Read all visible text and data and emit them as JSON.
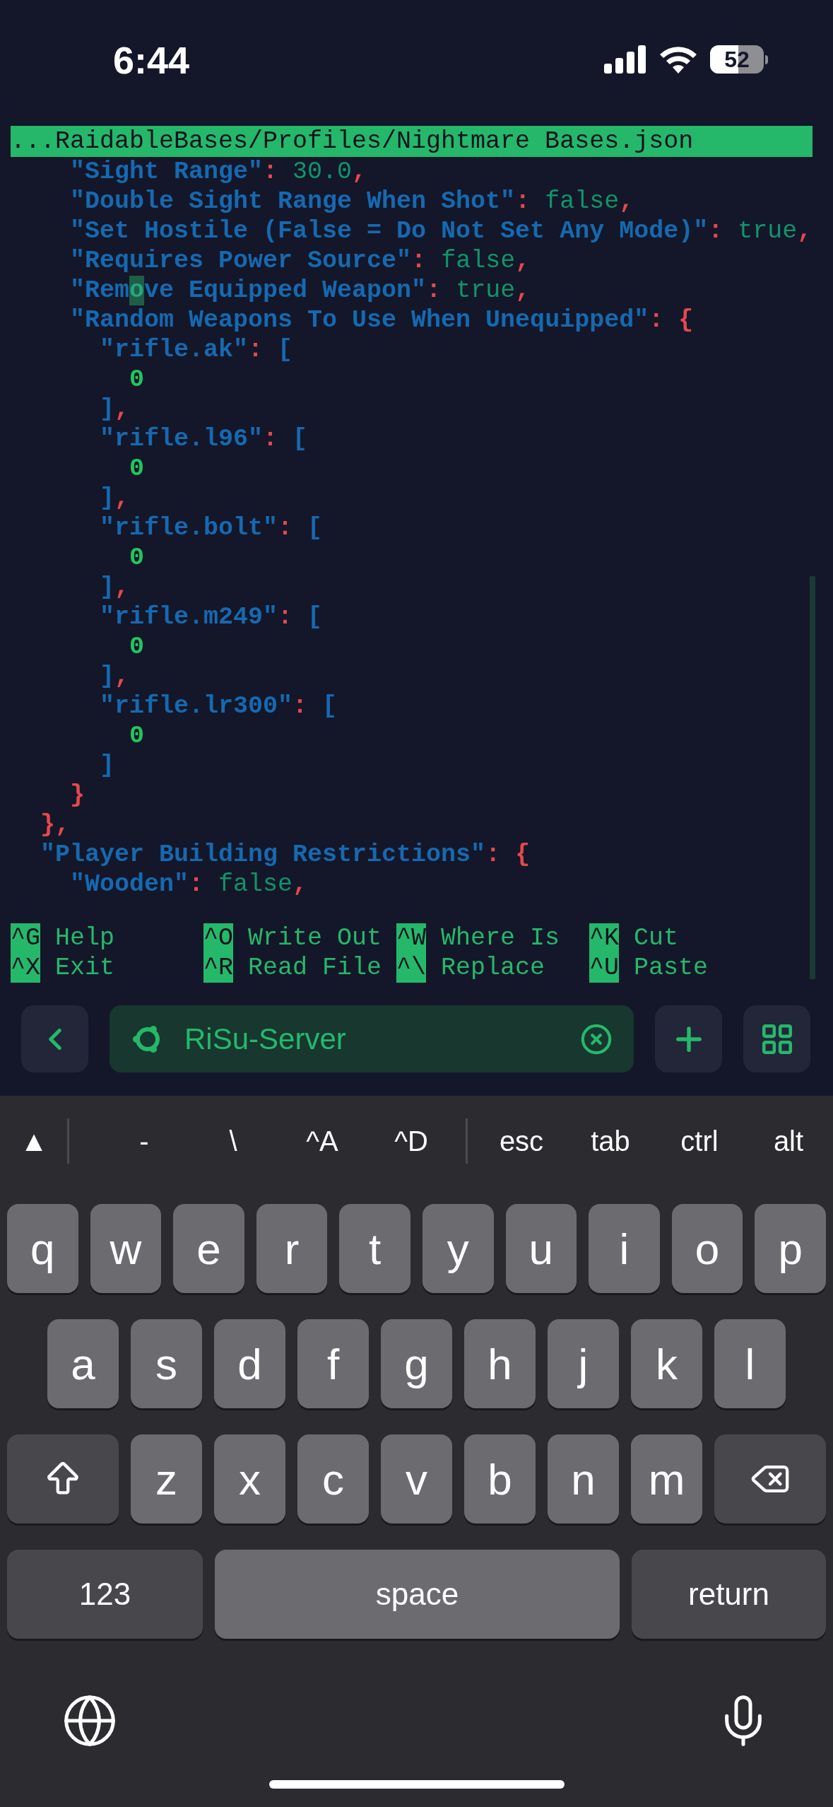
{
  "status_bar": {
    "time": "6:44",
    "battery": "52"
  },
  "editor": {
    "title": "...RaidableBases/Profiles/Nightmare Bases.json",
    "lines": [
      [
        {
          "t": "    \"Sight Range\"",
          "kind": "key"
        },
        {
          "t": ": ",
          "kind": "punct"
        },
        {
          "t": "30.0",
          "kind": "value"
        },
        {
          "t": ",",
          "kind": "punct"
        }
      ],
      [
        {
          "t": "    \"Double Sight Range When Shot\"",
          "kind": "key"
        },
        {
          "t": ": ",
          "kind": "punct"
        },
        {
          "t": "false",
          "kind": "value"
        },
        {
          "t": ",",
          "kind": "punct"
        }
      ],
      [
        {
          "t": "    \"Set Hostile (False = Do Not Set Any Mode)\"",
          "kind": "key"
        },
        {
          "t": ": ",
          "kind": "punct"
        },
        {
          "t": "true",
          "kind": "value"
        },
        {
          "t": ",",
          "kind": "punct"
        }
      ],
      [
        {
          "t": "    \"Requires Power Source\"",
          "kind": "key"
        },
        {
          "t": ": ",
          "kind": "punct"
        },
        {
          "t": "false",
          "kind": "value"
        },
        {
          "t": ",",
          "kind": "punct"
        }
      ],
      [
        {
          "t": "    \"Rem",
          "kind": "key"
        },
        {
          "t": "o",
          "kind": "cursor"
        },
        {
          "t": "ve Equipped Weapon\"",
          "kind": "key"
        },
        {
          "t": ": ",
          "kind": "punct"
        },
        {
          "t": "true",
          "kind": "value"
        },
        {
          "t": ",",
          "kind": "punct"
        }
      ],
      [
        {
          "t": "    \"Random Weapons To Use When Unequipped\"",
          "kind": "key"
        },
        {
          "t": ": ",
          "kind": "punct"
        },
        {
          "t": "{",
          "kind": "punct"
        }
      ],
      [
        {
          "t": "      \"rifle.ak\"",
          "kind": "key"
        },
        {
          "t": ": ",
          "kind": "punct"
        },
        {
          "t": "[",
          "kind": "bracket"
        }
      ],
      [
        {
          "t": "        0",
          "kind": "number"
        }
      ],
      [
        {
          "t": "      ]",
          "kind": "bracket"
        },
        {
          "t": ",",
          "kind": "punct"
        }
      ],
      [
        {
          "t": "      \"rifle.l96\"",
          "kind": "key"
        },
        {
          "t": ": ",
          "kind": "punct"
        },
        {
          "t": "[",
          "kind": "bracket"
        }
      ],
      [
        {
          "t": "        0",
          "kind": "number"
        }
      ],
      [
        {
          "t": "      ]",
          "kind": "bracket"
        },
        {
          "t": ",",
          "kind": "punct"
        }
      ],
      [
        {
          "t": "      \"rifle.bolt\"",
          "kind": "key"
        },
        {
          "t": ": ",
          "kind": "punct"
        },
        {
          "t": "[",
          "kind": "bracket"
        }
      ],
      [
        {
          "t": "        0",
          "kind": "number"
        }
      ],
      [
        {
          "t": "      ]",
          "kind": "bracket"
        },
        {
          "t": ",",
          "kind": "punct"
        }
      ],
      [
        {
          "t": "      \"rifle.m249\"",
          "kind": "key"
        },
        {
          "t": ": ",
          "kind": "punct"
        },
        {
          "t": "[",
          "kind": "bracket"
        }
      ],
      [
        {
          "t": "        0",
          "kind": "number"
        }
      ],
      [
        {
          "t": "      ]",
          "kind": "bracket"
        },
        {
          "t": ",",
          "kind": "punct"
        }
      ],
      [
        {
          "t": "      \"rifle.lr300\"",
          "kind": "key"
        },
        {
          "t": ": ",
          "kind": "punct"
        },
        {
          "t": "[",
          "kind": "bracket"
        }
      ],
      [
        {
          "t": "        0",
          "kind": "number"
        }
      ],
      [
        {
          "t": "      ]",
          "kind": "bracket"
        }
      ],
      [
        {
          "t": "    }",
          "kind": "punct"
        }
      ],
      [
        {
          "t": "  },",
          "kind": "punct"
        }
      ],
      [
        {
          "t": "  \"Player Building Restrictions\"",
          "kind": "key"
        },
        {
          "t": ": ",
          "kind": "punct"
        },
        {
          "t": "{",
          "kind": "punct"
        }
      ],
      [
        {
          "t": "    \"Wooden\"",
          "kind": "key"
        },
        {
          "t": ": ",
          "kind": "punct"
        },
        {
          "t": "false",
          "kind": "value"
        },
        {
          "t": ",",
          "kind": "punct"
        }
      ]
    ],
    "shortcuts": [
      {
        "key": "^G",
        "label": "Help"
      },
      {
        "key": "^O",
        "label": "Write Out"
      },
      {
        "key": "^W",
        "label": "Where Is"
      },
      {
        "key": "^K",
        "label": "Cut"
      },
      {
        "key": "^X",
        "label": "Exit"
      },
      {
        "key": "^R",
        "label": "Read File"
      },
      {
        "key": "^\\",
        "label": "Replace"
      },
      {
        "key": "^U",
        "label": "Paste"
      }
    ]
  },
  "session_bar": {
    "session": "RiSu-Server"
  },
  "extra_keys": [
    [
      "▲"
    ],
    [
      "-",
      "\\",
      "^A",
      "^D"
    ],
    [
      "esc",
      "tab",
      "ctrl",
      "alt"
    ]
  ],
  "keyboard": {
    "rows": [
      [
        "q",
        "w",
        "e",
        "r",
        "t",
        "y",
        "u",
        "i",
        "o",
        "p"
      ],
      [
        "a",
        "s",
        "d",
        "f",
        "g",
        "h",
        "j",
        "k",
        "l"
      ],
      [
        "z",
        "x",
        "c",
        "v",
        "b",
        "n",
        "m"
      ]
    ],
    "numbers": "123",
    "space": "space",
    "return": "return"
  }
}
